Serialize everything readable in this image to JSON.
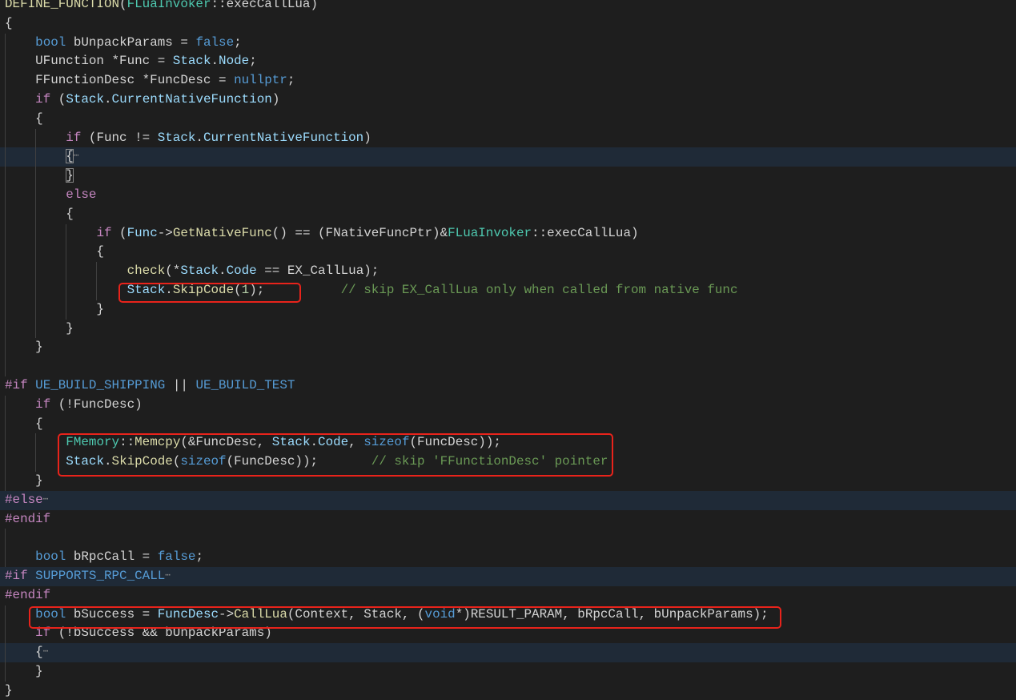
{
  "editor": {
    "lines": [
      {
        "tokens": [
          [
            "DEFINE_FUNCTION",
            "f"
          ],
          [
            "(",
            "p"
          ],
          [
            "FLuaInvoker",
            "t"
          ],
          [
            "::execCallLua)",
            "p"
          ]
        ]
      },
      {
        "tokens": [
          [
            "{",
            "p"
          ]
        ]
      },
      {
        "tokens": [
          [
            "    ",
            "p"
          ],
          [
            "bool",
            "k"
          ],
          [
            " bUnpackParams = ",
            "p"
          ],
          [
            "false",
            "k"
          ],
          [
            ";",
            "p"
          ]
        ]
      },
      {
        "tokens": [
          [
            "    UFunction *Func = ",
            "p"
          ],
          [
            "Stack",
            "v"
          ],
          [
            ".",
            "p"
          ],
          [
            "Node",
            "v"
          ],
          [
            ";",
            "p"
          ]
        ]
      },
      {
        "tokens": [
          [
            "    FFunctionDesc *FuncDesc = ",
            "p"
          ],
          [
            "nullptr",
            "k"
          ],
          [
            ";",
            "p"
          ]
        ]
      },
      {
        "tokens": [
          [
            "    ",
            "p"
          ],
          [
            "if",
            "c"
          ],
          [
            " (",
            "p"
          ],
          [
            "Stack",
            "v"
          ],
          [
            ".",
            "p"
          ],
          [
            "CurrentNativeFunction",
            "v"
          ],
          [
            ")",
            "p"
          ]
        ]
      },
      {
        "tokens": [
          [
            "    {",
            "p"
          ]
        ]
      },
      {
        "tokens": [
          [
            "        ",
            "p"
          ],
          [
            "if",
            "c"
          ],
          [
            " (Func != ",
            "p"
          ],
          [
            "Stack",
            "v"
          ],
          [
            ".",
            "p"
          ],
          [
            "CurrentNativeFunction",
            "v"
          ],
          [
            ")",
            "p"
          ]
        ]
      },
      {
        "folded": true,
        "tokens": [
          [
            "        ",
            "p"
          ],
          [
            "{",
            "match"
          ],
          [
            "⋯",
            "e"
          ]
        ]
      },
      {
        "tokens": [
          [
            "        ",
            "p"
          ],
          [
            "}",
            "match"
          ]
        ]
      },
      {
        "tokens": [
          [
            "        ",
            "p"
          ],
          [
            "else",
            "c"
          ]
        ]
      },
      {
        "tokens": [
          [
            "        {",
            "p"
          ]
        ]
      },
      {
        "tokens": [
          [
            "            ",
            "p"
          ],
          [
            "if",
            "c"
          ],
          [
            " (",
            "p"
          ],
          [
            "Func",
            "v"
          ],
          [
            "->",
            "p"
          ],
          [
            "GetNativeFunc",
            "f"
          ],
          [
            "() == (FNativeFuncPtr)&",
            "p"
          ],
          [
            "FLuaInvoker",
            "t"
          ],
          [
            "::execCallLua)",
            "p"
          ]
        ]
      },
      {
        "tokens": [
          [
            "            {",
            "p"
          ]
        ]
      },
      {
        "tokens": [
          [
            "                ",
            "p"
          ],
          [
            "check",
            "f"
          ],
          [
            "(*",
            "p"
          ],
          [
            "Stack",
            "v"
          ],
          [
            ".",
            "p"
          ],
          [
            "Code",
            "v"
          ],
          [
            " == EX_CallLua);",
            "p"
          ]
        ]
      },
      {
        "tokens": [
          [
            "                ",
            "p"
          ],
          [
            "Stack",
            "v"
          ],
          [
            ".",
            "p"
          ],
          [
            "SkipCode",
            "f"
          ],
          [
            "(",
            "p"
          ],
          [
            "1",
            "n"
          ],
          [
            ");          ",
            "p"
          ],
          [
            "// skip EX_CallLua only when called from native func",
            "m"
          ]
        ]
      },
      {
        "tokens": [
          [
            "            }",
            "p"
          ]
        ]
      },
      {
        "tokens": [
          [
            "        }",
            "p"
          ]
        ]
      },
      {
        "tokens": [
          [
            "    }",
            "p"
          ]
        ]
      },
      {
        "tokens": []
      },
      {
        "tokens": [
          [
            "#if",
            "c"
          ],
          [
            " ",
            "p"
          ],
          [
            "UE_BUILD_SHIPPING",
            "k"
          ],
          [
            " || ",
            "p"
          ],
          [
            "UE_BUILD_TEST",
            "k"
          ]
        ]
      },
      {
        "tokens": [
          [
            "    ",
            "p"
          ],
          [
            "if",
            "c"
          ],
          [
            " (!FuncDesc)",
            "p"
          ]
        ]
      },
      {
        "tokens": [
          [
            "    {",
            "p"
          ]
        ]
      },
      {
        "tokens": [
          [
            "        ",
            "p"
          ],
          [
            "FMemory",
            "t"
          ],
          [
            "::",
            "p"
          ],
          [
            "Memcpy",
            "f"
          ],
          [
            "(&FuncDesc, ",
            "p"
          ],
          [
            "Stack",
            "v"
          ],
          [
            ".",
            "p"
          ],
          [
            "Code",
            "v"
          ],
          [
            ", ",
            "p"
          ],
          [
            "sizeof",
            "k"
          ],
          [
            "(FuncDesc));",
            "p"
          ]
        ]
      },
      {
        "tokens": [
          [
            "        ",
            "p"
          ],
          [
            "Stack",
            "v"
          ],
          [
            ".",
            "p"
          ],
          [
            "SkipCode",
            "f"
          ],
          [
            "(",
            "p"
          ],
          [
            "sizeof",
            "k"
          ],
          [
            "(FuncDesc));       ",
            "p"
          ],
          [
            "// skip 'FFunctionDesc' pointer",
            "m"
          ]
        ]
      },
      {
        "tokens": [
          [
            "    }",
            "p"
          ]
        ]
      },
      {
        "folded": true,
        "tokens": [
          [
            "#else",
            "c"
          ],
          [
            "⋯",
            "e"
          ]
        ]
      },
      {
        "tokens": [
          [
            "#endif",
            "c"
          ]
        ]
      },
      {
        "tokens": []
      },
      {
        "tokens": [
          [
            "    ",
            "p"
          ],
          [
            "bool",
            "k"
          ],
          [
            " bRpcCall = ",
            "p"
          ],
          [
            "false",
            "k"
          ],
          [
            ";",
            "p"
          ]
        ]
      },
      {
        "folded": true,
        "tokens": [
          [
            "#if",
            "c"
          ],
          [
            " ",
            "p"
          ],
          [
            "SUPPORTS_RPC_CALL",
            "k"
          ],
          [
            "⋯",
            "e"
          ]
        ]
      },
      {
        "tokens": [
          [
            "#endif",
            "c"
          ]
        ]
      },
      {
        "tokens": [
          [
            "    ",
            "p"
          ],
          [
            "bool",
            "k"
          ],
          [
            " bSuccess = ",
            "p"
          ],
          [
            "FuncDesc",
            "v"
          ],
          [
            "->",
            "p"
          ],
          [
            "CallLua",
            "f"
          ],
          [
            "(Context, Stack, (",
            "p"
          ],
          [
            "void",
            "k"
          ],
          [
            "*)RESULT_PARAM, bRpcCall, bUnpackParams);",
            "p"
          ]
        ]
      },
      {
        "tokens": [
          [
            "    ",
            "p"
          ],
          [
            "if",
            "c"
          ],
          [
            " (!bSuccess && bUnpackParams)",
            "p"
          ]
        ]
      },
      {
        "folded": true,
        "tokens": [
          [
            "    {",
            "p"
          ],
          [
            "⋯",
            "e"
          ]
        ]
      },
      {
        "tokens": [
          [
            "    }",
            "p"
          ]
        ]
      },
      {
        "tokens": [
          [
            "}",
            "p"
          ]
        ]
      }
    ]
  },
  "annotations": {
    "highlight_color": "#e8231b"
  }
}
